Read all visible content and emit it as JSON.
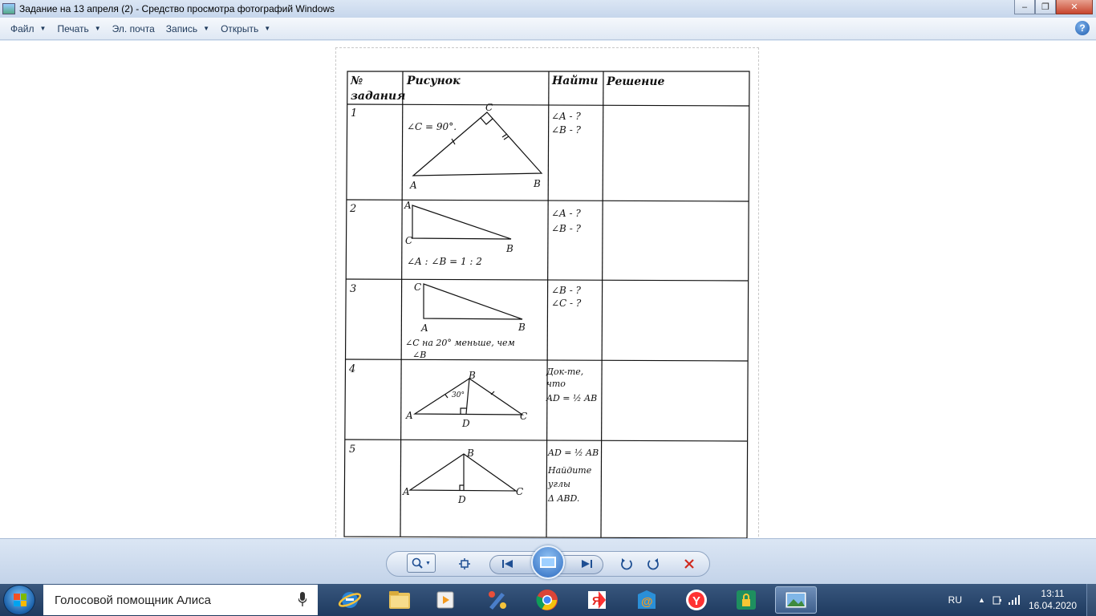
{
  "window": {
    "title": "Задание на  13 апреля (2) - Средство просмотра фотографий Windows",
    "min_label": "–",
    "max_label": "❐",
    "close_label": "✕"
  },
  "menu": {
    "items": [
      "Файл",
      "Печать",
      "Эл. почта",
      "Запись",
      "Открыть"
    ],
    "help_label": "?"
  },
  "document": {
    "headers": [
      "№ задания",
      "Рисунок",
      "Найти",
      "Решение"
    ],
    "header_no_line1": "№",
    "header_no_line2": "задания",
    "rows": [
      {
        "no": "1",
        "figure_note": "∠C = 90°.",
        "vertices": [
          "C",
          "A",
          "B"
        ],
        "find": [
          "∠A - ?",
          "∠B - ?"
        ]
      },
      {
        "no": "2",
        "figure_note": "∠A : ∠B = 1 : 2",
        "vertices": [
          "A",
          "C",
          "B"
        ],
        "find": [
          "∠A - ?",
          "∠B - ?"
        ]
      },
      {
        "no": "3",
        "figure_note_line1": "∠C на 20° меньше, чем",
        "figure_note_line2": "∠B",
        "vertices": [
          "C",
          "A",
          "B"
        ],
        "find": [
          "∠B - ?",
          "∠C - ?"
        ]
      },
      {
        "no": "4",
        "angle_label": "30°",
        "vertices": [
          "B",
          "A",
          "D",
          "C"
        ],
        "find": [
          "Док-те,",
          "что",
          "AD = ½ AB"
        ]
      },
      {
        "no": "5",
        "vertices": [
          "B",
          "A",
          "D",
          "C"
        ],
        "find": [
          "AD = ½ AB",
          "Найдите",
          "углы",
          "Δ ABD."
        ]
      }
    ]
  },
  "controls": {
    "zoom_icon": "magnifier-icon",
    "fit_icon": "fit-window-icon",
    "prev_icon": "previous-icon",
    "slideshow_icon": "slideshow-icon",
    "next_icon": "next-icon",
    "rotate_ccw_icon": "rotate-ccw-icon",
    "rotate_cw_icon": "rotate-cw-icon",
    "delete_icon": "delete-icon"
  },
  "taskbar": {
    "search_text": "Голосовой помощник Алиса",
    "apps": [
      "ie-icon",
      "explorer-icon",
      "media-player-icon",
      "paint-icon",
      "chrome-icon",
      "yandex-icon",
      "mail-ru-icon",
      "yandex-browser-icon",
      "security-icon",
      "photo-viewer-icon"
    ],
    "lang": "RU",
    "time": "13:11",
    "date": "16.04.2020"
  },
  "colors": {
    "accent": "#1f5cad",
    "close_red": "#c7452e",
    "taskbar": "#1e3a5f"
  }
}
